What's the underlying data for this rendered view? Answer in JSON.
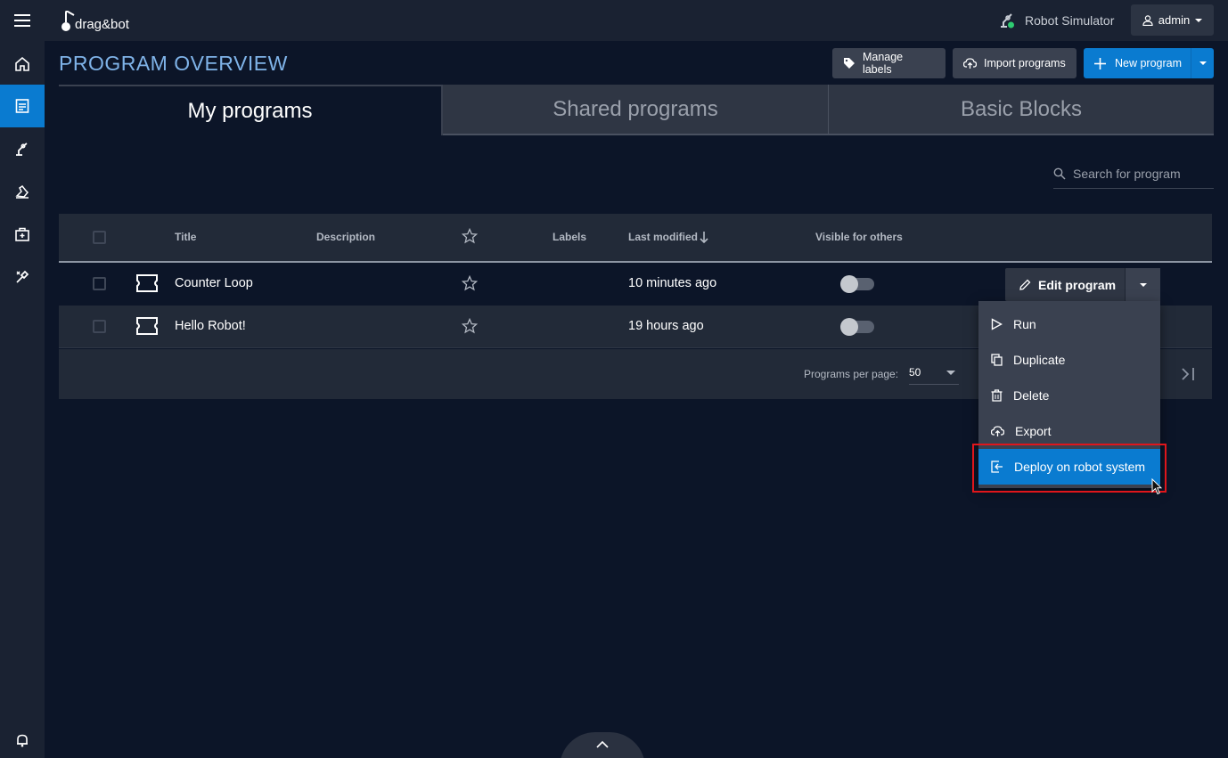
{
  "app": {
    "logo_text": "drag&bot",
    "robot_name": "Robot Simulator",
    "user": "admin",
    "robot_status_color": "#2ecc71"
  },
  "sidebar": {
    "items": [
      {
        "name": "home",
        "icon": "home-icon",
        "active": false
      },
      {
        "name": "programs",
        "icon": "program-list-icon",
        "active": true
      },
      {
        "name": "robot",
        "icon": "robot-arm-icon",
        "active": false
      },
      {
        "name": "skills",
        "icon": "hand-icon",
        "active": false
      },
      {
        "name": "apps",
        "icon": "toolbox-icon",
        "active": false
      },
      {
        "name": "tools",
        "icon": "wrench-icon",
        "active": false
      }
    ],
    "bottom_icon": "bell-icon"
  },
  "header": {
    "title": "PROGRAM OVERVIEW",
    "manage_labels": "Manage labels",
    "import_programs": "Import programs",
    "new_program": "New program"
  },
  "tabs": [
    {
      "label": "My programs",
      "active": true
    },
    {
      "label": "Shared programs",
      "active": false
    },
    {
      "label": "Basic Blocks",
      "active": false
    }
  ],
  "search": {
    "placeholder": "Search for program"
  },
  "table": {
    "columns": {
      "title": "Title",
      "description": "Description",
      "labels": "Labels",
      "last_modified": "Last modified",
      "visible": "Visible for others"
    },
    "rows": [
      {
        "title": "Counter Loop",
        "description": "",
        "modified": "10 minutes ago",
        "visible": false
      },
      {
        "title": "Hello Robot!",
        "description": "",
        "modified": "19 hours ago",
        "visible": false
      }
    ],
    "per_page_label": "Programs per page:",
    "per_page_value": "50"
  },
  "edit_button": {
    "label": "Edit program"
  },
  "menu": {
    "items": [
      {
        "label": "Run",
        "icon": "play-icon"
      },
      {
        "label": "Duplicate",
        "icon": "duplicate-icon"
      },
      {
        "label": "Delete",
        "icon": "trash-icon"
      },
      {
        "label": "Export",
        "icon": "cloud-upload-icon"
      },
      {
        "label": "Deploy on robot system",
        "icon": "deploy-icon",
        "highlighted": true
      }
    ]
  },
  "colors": {
    "accent": "#0a7bd0",
    "background": "#0c1528",
    "panel": "#1a2232",
    "highlight_box": "#e0161b"
  }
}
